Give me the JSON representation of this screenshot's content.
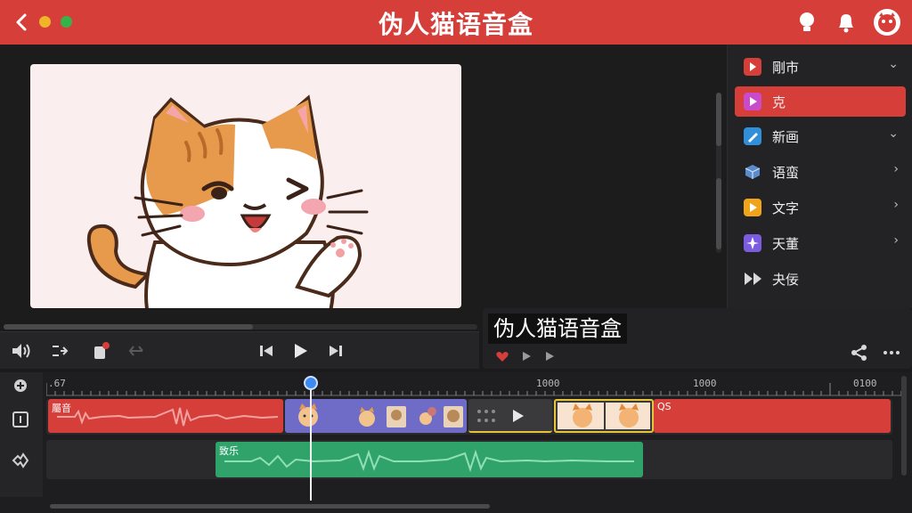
{
  "app": {
    "title": "伪人猫语音盒"
  },
  "sidebar": {
    "items": [
      {
        "label": "剛市",
        "icon": "video-clip-icon",
        "color": "#d63e3a",
        "chevron": "chevron-down",
        "active": false
      },
      {
        "label": "克",
        "icon": "play-square-icon",
        "color": "#c94bc9",
        "chevron": "",
        "active": true
      },
      {
        "label": "新画",
        "icon": "pencil-icon",
        "color": "#2f8fd8",
        "chevron": "chevron-down",
        "active": false
      },
      {
        "label": "语蛮",
        "icon": "cube-icon",
        "color": "#5a8ccc",
        "chevron": "chevron-right",
        "active": false
      },
      {
        "label": "文字",
        "icon": "text-play-icon",
        "color": "#f0a41a",
        "chevron": "chevron-right",
        "active": false
      },
      {
        "label": "天董",
        "icon": "sparkle-icon",
        "color": "#7b5be0",
        "chevron": "chevron-right",
        "active": false
      },
      {
        "label": "夬佞",
        "icon": "fast-forward-icon",
        "color": "#d8d8d8",
        "chevron": "",
        "active": false
      }
    ]
  },
  "text_panel": {
    "title": "伪人猫语音盒"
  },
  "timeline": {
    "ruler": [
      {
        "label": ".67"
      },
      {
        "label": "1000"
      },
      {
        "label": "1000"
      },
      {
        "label": "0100"
      }
    ],
    "clips": {
      "red_clip_label": "屬音",
      "red_clip_label2": "QS",
      "green_clip_label": "致乐"
    }
  },
  "colors": {
    "accent": "#d63e3a",
    "playhead": "#3d8bf0",
    "audio_green": "#2fa36a",
    "clip_purple": "#6f6cc8",
    "clip_yellow_border": "#e5c43a"
  }
}
